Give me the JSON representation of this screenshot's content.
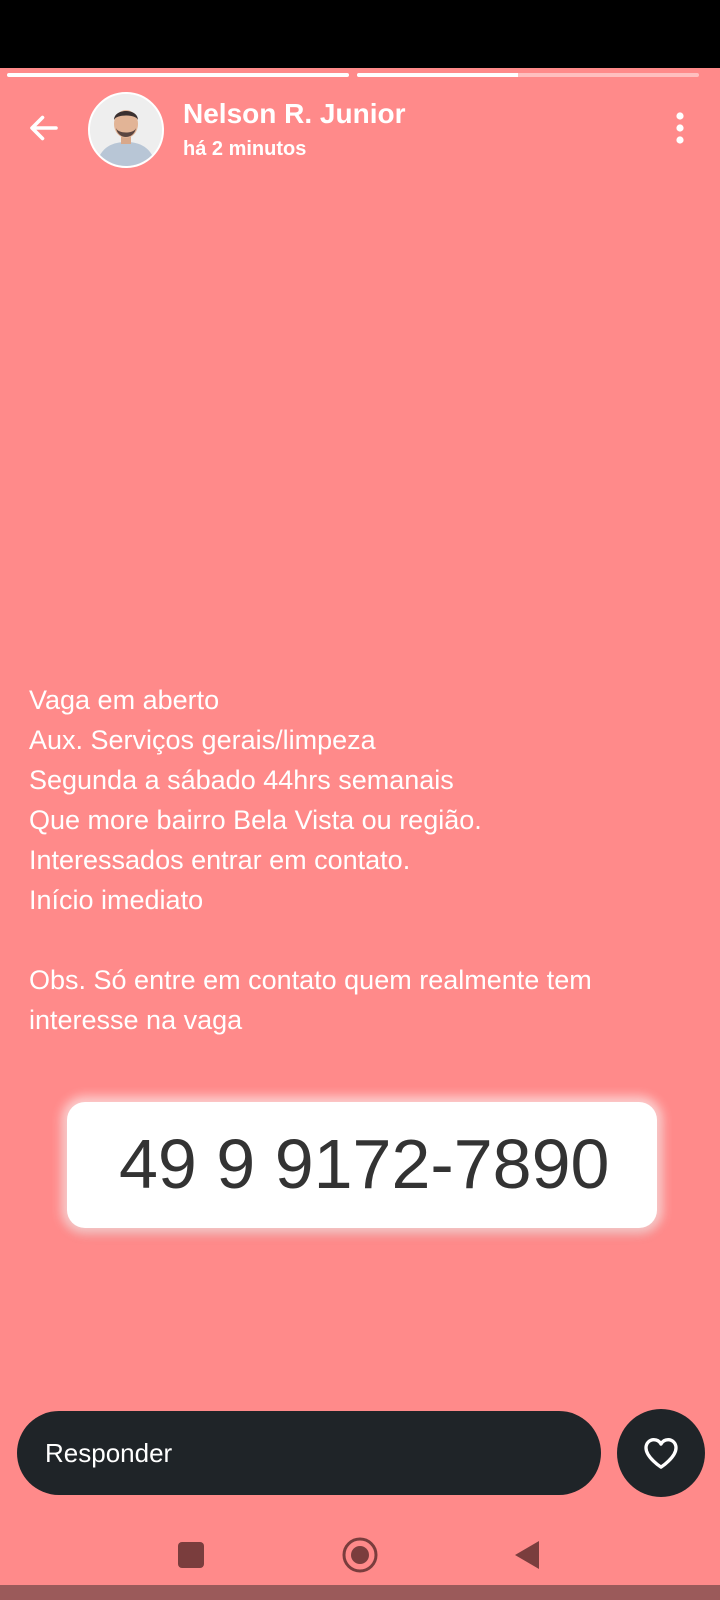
{
  "story": {
    "progress_segments": [
      1.0,
      0.47
    ],
    "author_name": "Nelson R. Junior",
    "time_posted": "há 2 minutos",
    "background_color": "#ff8a8a"
  },
  "icons": {
    "back": "arrow-left-icon",
    "menu": "more-vertical-icon",
    "like": "heart-icon",
    "nav_recents": "square-icon",
    "nav_home": "circle-icon",
    "nav_back": "triangle-back-icon"
  },
  "message": {
    "lines": [
      "Vaga em aberto",
      "Aux. Serviços gerais/limpeza",
      "Segunda a sábado 44hrs semanais",
      "Que more bairro Bela Vista ou região.",
      "Interessados entrar em contato.",
      "Início imediato",
      "",
      "Obs. Só entre em contato quem realmente tem",
      "interesse na vaga"
    ]
  },
  "phone_number": "49 9 9172-7890",
  "reply": {
    "placeholder": "Responder"
  }
}
